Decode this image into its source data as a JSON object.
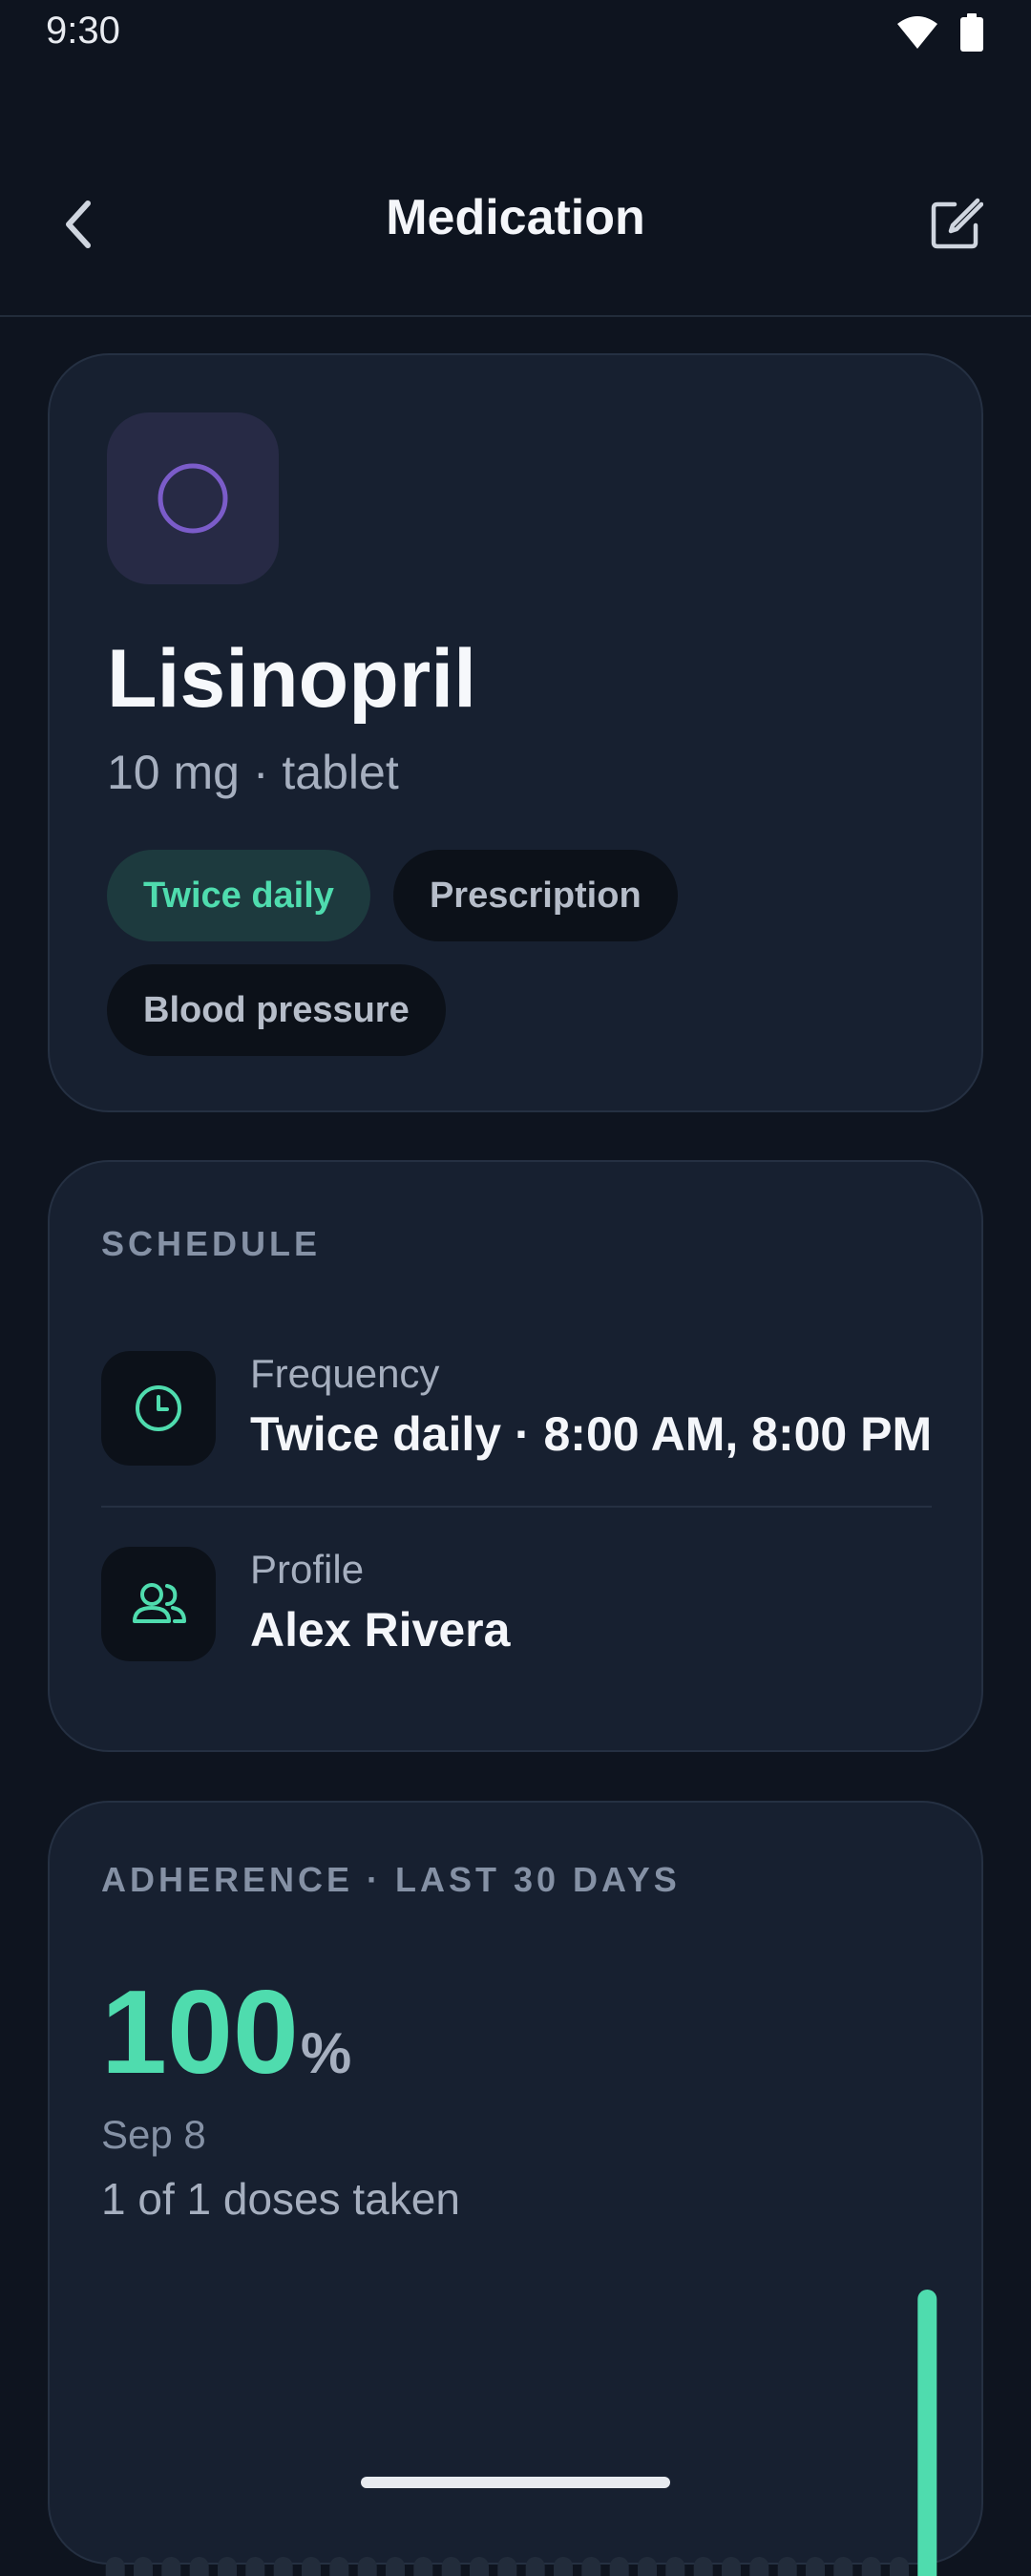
{
  "status_bar": {
    "time": "9:30"
  },
  "header": {
    "title": "Medication"
  },
  "medication": {
    "name": "Lisinopril",
    "dose": "10 mg · tablet",
    "tags": [
      "Twice daily",
      "Prescription",
      "Blood pressure"
    ],
    "icon_color": "#7b5cc9"
  },
  "schedule": {
    "section_label": "SCHEDULE",
    "frequency_label": "Frequency",
    "frequency_value": "Twice daily · 8:00 AM, 8:00 PM",
    "profile_label": "Profile",
    "profile_value": "Alex Rivera"
  },
  "adherence": {
    "section_label": "ADHERENCE · LAST 30 DAYS",
    "percent_value": "100",
    "percent_unit": "%",
    "date": "Sep 8",
    "doses": "1 of 1 doses taken",
    "accent_color": "#4fdcae"
  },
  "chart_data": {
    "type": "bar",
    "categories_count_note": "",
    "values": [
      0,
      0,
      0,
      0,
      0,
      0,
      0,
      0,
      0,
      0,
      0,
      0,
      0,
      0,
      0,
      0,
      0,
      0,
      0,
      0,
      0,
      0,
      0,
      0,
      0,
      0,
      0,
      0,
      0,
      1
    ],
    "ylim": [
      0,
      1
    ]
  }
}
